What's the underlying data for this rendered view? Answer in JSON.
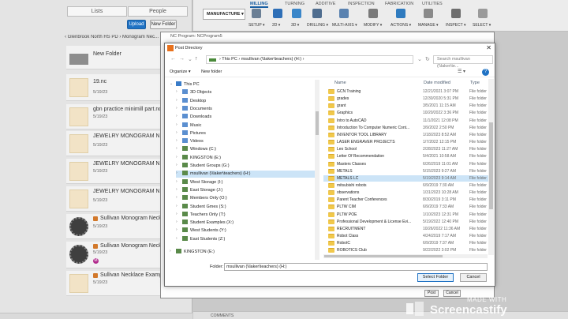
{
  "left_panel": {
    "tabs": [
      "Lists",
      "People"
    ],
    "upload_label": "Upload",
    "new_folder_label": "New Folder",
    "breadcrumb": "‹  Glenbrook North HS PD  ›  Monogram Nec...",
    "items": [
      {
        "name": "New Folder",
        "date": "",
        "kind": "folder"
      },
      {
        "name": "19.nc",
        "date": "5/19/23",
        "kind": "part"
      },
      {
        "name": "gbn practice minimill part.nc",
        "date": "5/19/23",
        "kind": "part"
      },
      {
        "name": "JEWELRY MONOGRAM NEC",
        "date": "5/19/23",
        "kind": "part"
      },
      {
        "name": "JEWELRY MONOGRAM NEC",
        "date": "5/19/23",
        "kind": "part"
      },
      {
        "name": "JEWELRY MONOGRAM NEC",
        "date": "5/19/23",
        "kind": "part"
      },
      {
        "name": "Sullivan Monogram Necklace",
        "date": "5/19/23",
        "kind": "ring"
      },
      {
        "name": "Sullivan Monogram Necklace",
        "date": "5/19/23",
        "kind": "ring"
      },
      {
        "name": "Sullivan Necklace Example",
        "date": "5/19/23",
        "kind": "part"
      }
    ]
  },
  "ribbon": {
    "tabs": [
      "MILLING",
      "TURNING",
      "ADDITIVE",
      "INSPECTION",
      "FABRICATION",
      "UTILITIES"
    ],
    "workspace": "MANUFACTURE ▾",
    "groups": [
      "SETUP ▾",
      "2D ▾",
      "3D ▾",
      "DRILLING ▾",
      "MULTI-AXIS ▾",
      "MODIFY ▾",
      "ACTIONS ▾",
      "MANAGE ▾",
      "INSPECT ▾",
      "SELECT ▾"
    ]
  },
  "nc_dialog": {
    "title": "NC Program: NCProgram5",
    "post_label": "Post",
    "cancel_label": "Cancel"
  },
  "post_dialog": {
    "title": "Post Directory",
    "close": "✕",
    "address": "›  This PC  ›  msullivan (\\\\laker\\teachers) (H:)  ›",
    "search_placeholder": "Search msullivan (\\\\laker\\te...",
    "organize": "Organize ▾",
    "new_folder": "New folder",
    "help": "?",
    "nav": [
      {
        "label": "This PC",
        "level": 0,
        "expanded": true
      },
      {
        "label": "3D Objects",
        "level": 1
      },
      {
        "label": "Desktop",
        "level": 1
      },
      {
        "label": "Documents",
        "level": 1
      },
      {
        "label": "Downloads",
        "level": 1
      },
      {
        "label": "Music",
        "level": 1
      },
      {
        "label": "Pictures",
        "level": 1
      },
      {
        "label": "Videos",
        "level": 1
      },
      {
        "label": "Windows (C:)",
        "level": 1
      },
      {
        "label": "KINGSTON (E:)",
        "level": 1
      },
      {
        "label": "Student Groups (G:)",
        "level": 1
      },
      {
        "label": "msullivan (\\\\laker\\teachers) (H:)",
        "level": 1,
        "selected": true
      },
      {
        "label": "West Storage (I:)",
        "level": 1
      },
      {
        "label": "East Storage (J:)",
        "level": 1
      },
      {
        "label": "Members Only (O:)",
        "level": 1
      },
      {
        "label": "Student Gmes (S:)",
        "level": 1
      },
      {
        "label": "Teachers Only (T:)",
        "level": 1
      },
      {
        "label": "Student Examples (X:)",
        "level": 1
      },
      {
        "label": "West Students (Y:)",
        "level": 1
      },
      {
        "label": "East Students (Z:)",
        "level": 1
      },
      {
        "label": "KINGSTON (E:)",
        "level": 0
      }
    ],
    "columns": [
      "Name",
      "Date modified",
      "Type"
    ],
    "files": [
      {
        "name": "GCN Training",
        "date": "12/21/2021 3:07 PM",
        "type": "File folder"
      },
      {
        "name": "grades",
        "date": "12/30/2020 5:31 PM",
        "type": "File folder"
      },
      {
        "name": "grant",
        "date": "3/5/2021 11:15 AM",
        "type": "File folder"
      },
      {
        "name": "Graphics",
        "date": "10/20/2022 3:36 PM",
        "type": "File folder"
      },
      {
        "name": "Intro to AutoCAD",
        "date": "11/1/2021 12:08 PM",
        "type": "File folder"
      },
      {
        "name": "Introduction To Computer Numeric Cont...",
        "date": "3/9/2022 2:50 PM",
        "type": "File folder"
      },
      {
        "name": "INVENTOR TOOL LIBRARY",
        "date": "1/18/2023 8:52 AM",
        "type": "File folder"
      },
      {
        "name": "LASER ENGRAVER PROJECTS",
        "date": "1/7/2022 12:15 PM",
        "type": "File folder"
      },
      {
        "name": "Leo School",
        "date": "2/28/2023 11:27 AM",
        "type": "File folder"
      },
      {
        "name": "Letter Of Recommendation",
        "date": "5/4/2021 10:58 AM",
        "type": "File folder"
      },
      {
        "name": "Masters Classes",
        "date": "6/26/2019 11:01 AM",
        "type": "File folder"
      },
      {
        "name": "METALS",
        "date": "5/15/2023 9:27 AM",
        "type": "File folder"
      },
      {
        "name": "METALS LC",
        "date": "5/19/2023 9:14 AM",
        "type": "File folder",
        "selected": true
      },
      {
        "name": "mitsubishi robots",
        "date": "6/9/2019 7:30 AM",
        "type": "File folder"
      },
      {
        "name": "observations",
        "date": "1/31/2023 10:28 AM",
        "type": "File folder"
      },
      {
        "name": "Parent Teacher Conferences",
        "date": "8/30/2019 3:11 PM",
        "type": "File folder"
      },
      {
        "name": "PLTW CIM",
        "date": "6/9/2019 7:33 AM",
        "type": "File folder"
      },
      {
        "name": "PLTW POE",
        "date": "1/10/2023 12:31 PM",
        "type": "File folder"
      },
      {
        "name": "Professional Development & License Evi...",
        "date": "5/19/2022 12:40 PM",
        "type": "File folder"
      },
      {
        "name": "RECRUITMENT",
        "date": "10/26/2022 11:36 AM",
        "type": "File folder"
      },
      {
        "name": "Robot Class",
        "date": "4/24/2019 7:17 AM",
        "type": "File folder"
      },
      {
        "name": "RobotC",
        "date": "6/9/2019 7:37 AM",
        "type": "File folder"
      },
      {
        "name": "ROBOTICS Club",
        "date": "9/22/2022 3:02 PM",
        "type": "File folder"
      }
    ],
    "folder_label": "Folder:",
    "folder_value": "msullivan (\\\\laker\\teachers) (H:)",
    "select_folder": "Select Folder",
    "cancel": "Cancel"
  },
  "bottom_bar": {
    "comments": "COMMENTS"
  },
  "watermark": {
    "made_with": "MADE WITH",
    "brand": "Screencastify"
  },
  "colors": {
    "accent": "#1f72c4",
    "folder": "#f1c84b",
    "selected_row": "#cce4f7"
  }
}
